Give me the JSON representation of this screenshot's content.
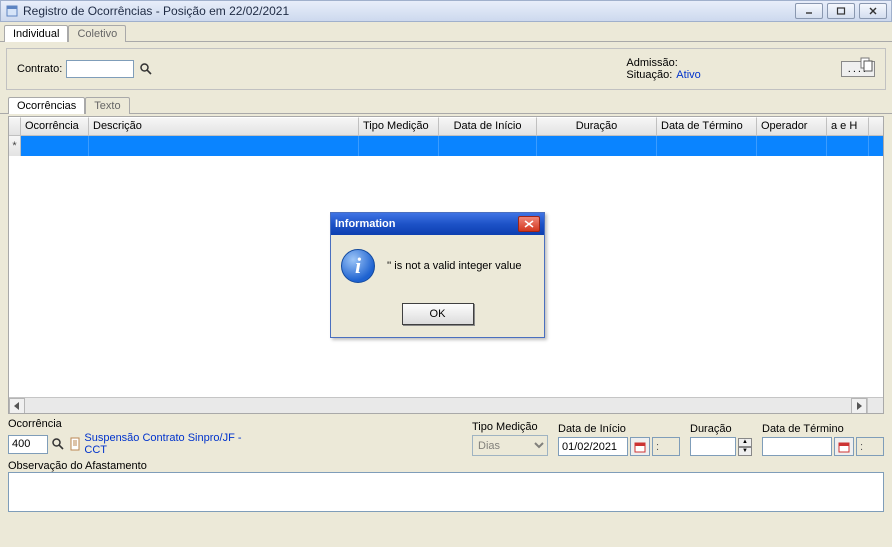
{
  "window": {
    "title": "Registro de Ocorrências - Posição em 22/02/2021"
  },
  "main_tabs": {
    "individual": "Individual",
    "coletivo": "Coletivo"
  },
  "header": {
    "contrato_label": "Contrato:",
    "contrato_value": "",
    "admissao_label": "Admissão:",
    "admissao_value": "",
    "situacao_label": "Situação:",
    "situacao_value": "Ativo",
    "dots": "...."
  },
  "sub_tabs": {
    "ocorrencias": "Ocorrências",
    "texto": "Texto"
  },
  "grid": {
    "columns": {
      "ocorrencia": "Ocorrência",
      "descricao": "Descrição",
      "tipo_medicao": "Tipo Medição",
      "data_inicio": "Data de Início",
      "duracao": "Duração",
      "data_termino": "Data de Término",
      "operador": "Operador",
      "aeh": "a e H"
    },
    "new_row_marker": "*"
  },
  "detail": {
    "ocorrencia_label": "Ocorrência",
    "ocorrencia_value": "400",
    "ocorrencia_desc": "Suspensão Contrato Sinpro/JF - CCT",
    "tipo_medicao_label": "Tipo Medição",
    "tipo_medicao_value": "Dias",
    "data_inicio_label": "Data de Início",
    "data_inicio_value": "01/02/2021",
    "hora_inicio_value": ":",
    "duracao_label": "Duração",
    "duracao_value": "",
    "data_termino_label": "Data de Término",
    "data_termino_value": "",
    "hora_termino_value": ":",
    "observacao_label": "Observação do Afastamento",
    "observacao_value": ""
  },
  "modal": {
    "title": "Information",
    "message": "'' is not a valid integer value",
    "ok": "OK"
  }
}
